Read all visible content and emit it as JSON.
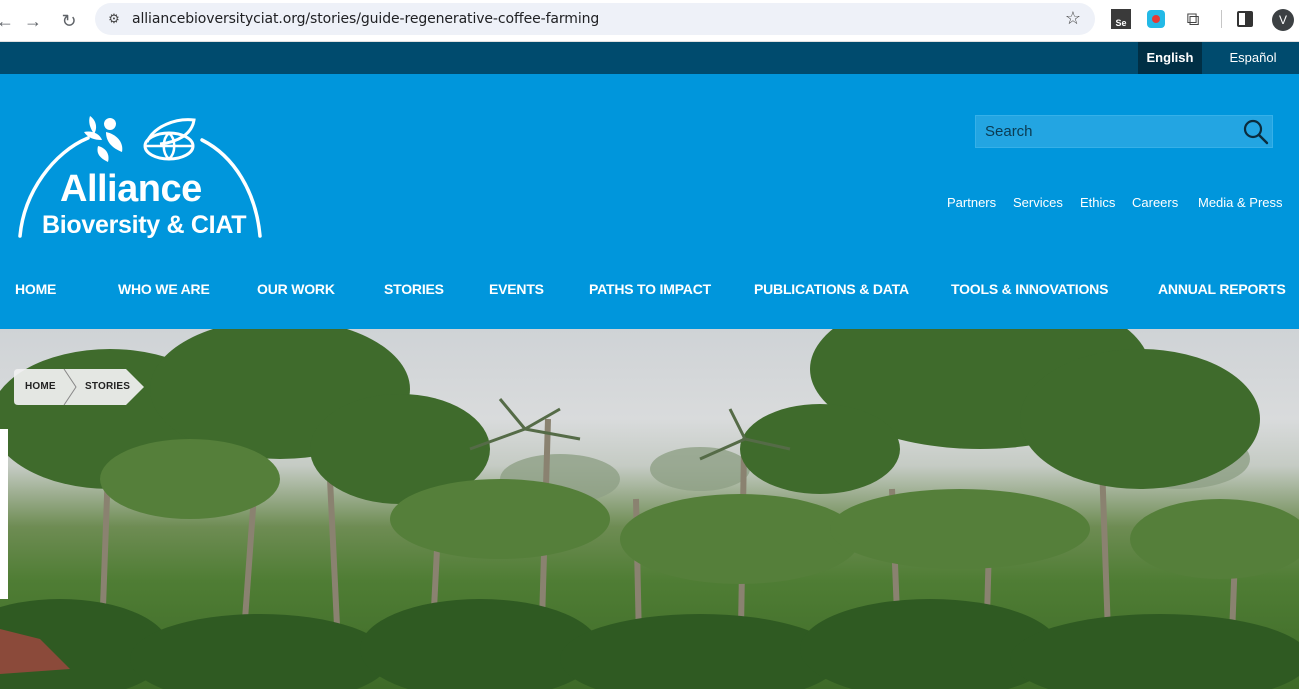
{
  "browser": {
    "url": "alliancebioversityciat.org/stories/guide-regenerative-coffee-farming",
    "profile_initial": "V",
    "extension_se_label": "Se"
  },
  "language": {
    "options": [
      "English",
      "Español"
    ],
    "selected": "English"
  },
  "logo": {
    "line1": "Alliance",
    "line2": "Bioversity & CIAT"
  },
  "search": {
    "placeholder": "Search"
  },
  "utility_nav": [
    "Partners",
    "Services",
    "Ethics",
    "Careers",
    "Media & Press"
  ],
  "main_nav": [
    "HOME",
    "WHO WE ARE",
    "OUR WORK",
    "STORIES",
    "EVENTS",
    "PATHS TO IMPACT",
    "PUBLICATIONS & DATA",
    "TOOLS & INNOVATIONS",
    "ANNUAL REPORTS"
  ],
  "breadcrumb": [
    "HOME",
    "STORIES"
  ],
  "colors": {
    "language_bar": "#004b6e",
    "header": "#0096dc",
    "selected_language": "#002f45"
  }
}
